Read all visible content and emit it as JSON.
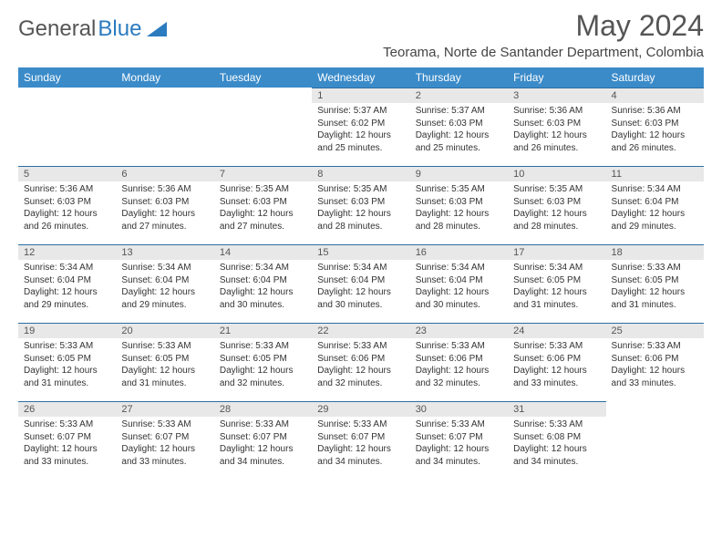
{
  "logo": {
    "part1": "General",
    "part2": "Blue"
  },
  "title": "May 2024",
  "subtitle": "Teorama, Norte de Santander Department, Colombia",
  "weekdays": [
    "Sunday",
    "Monday",
    "Tuesday",
    "Wednesday",
    "Thursday",
    "Friday",
    "Saturday"
  ],
  "labels": {
    "sunrise": "Sunrise: ",
    "sunset": "Sunset: ",
    "daylight": "Daylight: "
  },
  "weeks": [
    [
      null,
      null,
      null,
      {
        "n": "1",
        "sr": "5:37 AM",
        "ss": "6:02 PM",
        "dl": "12 hours and 25 minutes."
      },
      {
        "n": "2",
        "sr": "5:37 AM",
        "ss": "6:03 PM",
        "dl": "12 hours and 25 minutes."
      },
      {
        "n": "3",
        "sr": "5:36 AM",
        "ss": "6:03 PM",
        "dl": "12 hours and 26 minutes."
      },
      {
        "n": "4",
        "sr": "5:36 AM",
        "ss": "6:03 PM",
        "dl": "12 hours and 26 minutes."
      }
    ],
    [
      {
        "n": "5",
        "sr": "5:36 AM",
        "ss": "6:03 PM",
        "dl": "12 hours and 26 minutes."
      },
      {
        "n": "6",
        "sr": "5:36 AM",
        "ss": "6:03 PM",
        "dl": "12 hours and 27 minutes."
      },
      {
        "n": "7",
        "sr": "5:35 AM",
        "ss": "6:03 PM",
        "dl": "12 hours and 27 minutes."
      },
      {
        "n": "8",
        "sr": "5:35 AM",
        "ss": "6:03 PM",
        "dl": "12 hours and 28 minutes."
      },
      {
        "n": "9",
        "sr": "5:35 AM",
        "ss": "6:03 PM",
        "dl": "12 hours and 28 minutes."
      },
      {
        "n": "10",
        "sr": "5:35 AM",
        "ss": "6:03 PM",
        "dl": "12 hours and 28 minutes."
      },
      {
        "n": "11",
        "sr": "5:34 AM",
        "ss": "6:04 PM",
        "dl": "12 hours and 29 minutes."
      }
    ],
    [
      {
        "n": "12",
        "sr": "5:34 AM",
        "ss": "6:04 PM",
        "dl": "12 hours and 29 minutes."
      },
      {
        "n": "13",
        "sr": "5:34 AM",
        "ss": "6:04 PM",
        "dl": "12 hours and 29 minutes."
      },
      {
        "n": "14",
        "sr": "5:34 AM",
        "ss": "6:04 PM",
        "dl": "12 hours and 30 minutes."
      },
      {
        "n": "15",
        "sr": "5:34 AM",
        "ss": "6:04 PM",
        "dl": "12 hours and 30 minutes."
      },
      {
        "n": "16",
        "sr": "5:34 AM",
        "ss": "6:04 PM",
        "dl": "12 hours and 30 minutes."
      },
      {
        "n": "17",
        "sr": "5:34 AM",
        "ss": "6:05 PM",
        "dl": "12 hours and 31 minutes."
      },
      {
        "n": "18",
        "sr": "5:33 AM",
        "ss": "6:05 PM",
        "dl": "12 hours and 31 minutes."
      }
    ],
    [
      {
        "n": "19",
        "sr": "5:33 AM",
        "ss": "6:05 PM",
        "dl": "12 hours and 31 minutes."
      },
      {
        "n": "20",
        "sr": "5:33 AM",
        "ss": "6:05 PM",
        "dl": "12 hours and 31 minutes."
      },
      {
        "n": "21",
        "sr": "5:33 AM",
        "ss": "6:05 PM",
        "dl": "12 hours and 32 minutes."
      },
      {
        "n": "22",
        "sr": "5:33 AM",
        "ss": "6:06 PM",
        "dl": "12 hours and 32 minutes."
      },
      {
        "n": "23",
        "sr": "5:33 AM",
        "ss": "6:06 PM",
        "dl": "12 hours and 32 minutes."
      },
      {
        "n": "24",
        "sr": "5:33 AM",
        "ss": "6:06 PM",
        "dl": "12 hours and 33 minutes."
      },
      {
        "n": "25",
        "sr": "5:33 AM",
        "ss": "6:06 PM",
        "dl": "12 hours and 33 minutes."
      }
    ],
    [
      {
        "n": "26",
        "sr": "5:33 AM",
        "ss": "6:07 PM",
        "dl": "12 hours and 33 minutes."
      },
      {
        "n": "27",
        "sr": "5:33 AM",
        "ss": "6:07 PM",
        "dl": "12 hours and 33 minutes."
      },
      {
        "n": "28",
        "sr": "5:33 AM",
        "ss": "6:07 PM",
        "dl": "12 hours and 34 minutes."
      },
      {
        "n": "29",
        "sr": "5:33 AM",
        "ss": "6:07 PM",
        "dl": "12 hours and 34 minutes."
      },
      {
        "n": "30",
        "sr": "5:33 AM",
        "ss": "6:07 PM",
        "dl": "12 hours and 34 minutes."
      },
      {
        "n": "31",
        "sr": "5:33 AM",
        "ss": "6:08 PM",
        "dl": "12 hours and 34 minutes."
      },
      null
    ]
  ]
}
